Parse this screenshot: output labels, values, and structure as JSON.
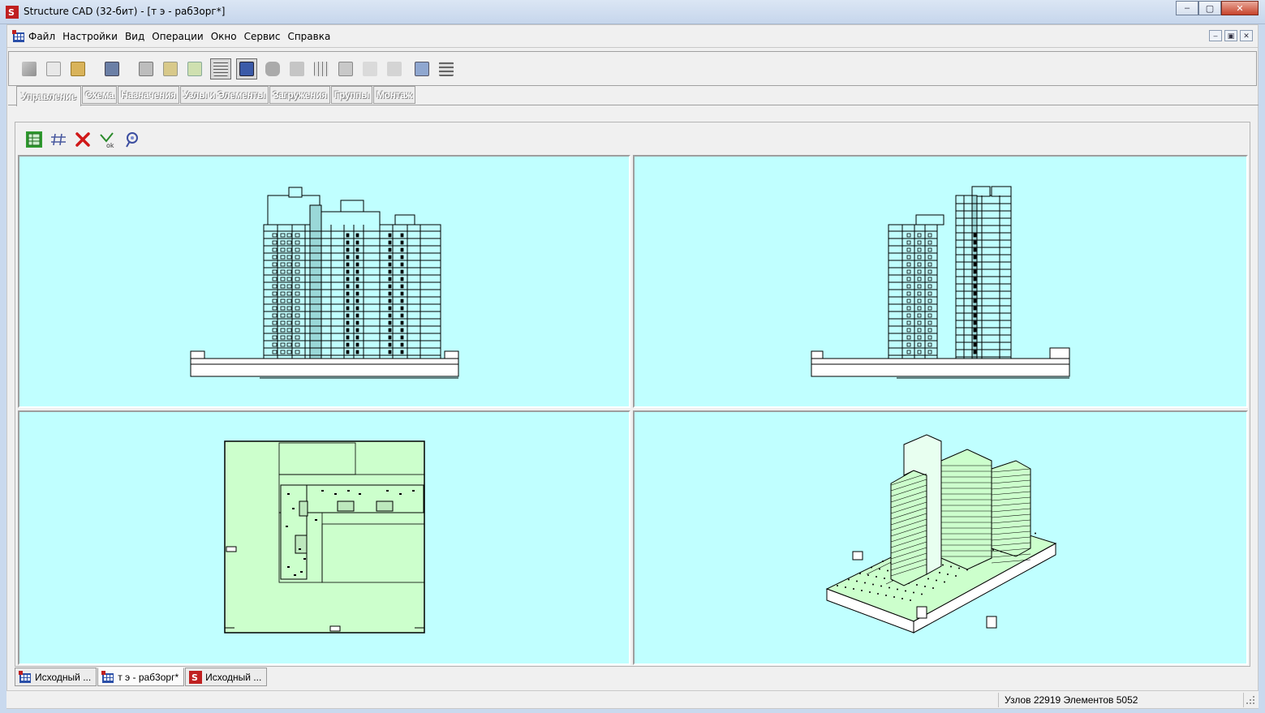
{
  "window": {
    "title": "Structure CAD (32-бит) - [т э - раб3орг*]",
    "controls": {
      "minimize": "‒",
      "maximize": "▢",
      "close": "✕"
    }
  },
  "menu": {
    "items": [
      "Файл",
      "Настройки",
      "Вид",
      "Операции",
      "Окно",
      "Сервис",
      "Справка"
    ],
    "mdi_controls": {
      "minimize": "‒",
      "restore": "▣",
      "close": "✕"
    }
  },
  "toolbar": {
    "buttons": [
      {
        "icon": "export-icon"
      },
      {
        "icon": "new-file-icon"
      },
      {
        "icon": "open-folder-icon"
      },
      {
        "icon": "save-icon"
      },
      {
        "icon": "print-icon"
      },
      {
        "icon": "tree-icon"
      },
      {
        "icon": "scheme-edit-icon"
      },
      {
        "icon": "grid-view-icon",
        "pressed": true
      },
      {
        "icon": "calculator-icon",
        "pressed": true
      },
      {
        "icon": "camera-icon"
      },
      {
        "icon": "results-icon"
      },
      {
        "icon": "table-icon"
      },
      {
        "icon": "docs-icon"
      },
      {
        "icon": "graph-icon"
      },
      {
        "icon": "analysis-icon"
      },
      {
        "icon": "design-icon"
      },
      {
        "icon": "report-icon"
      }
    ]
  },
  "tabs": [
    {
      "label": "Управление",
      "active": true
    },
    {
      "label": "Схема"
    },
    {
      "label": "Назначения"
    },
    {
      "label": "Узлы и Элементы"
    },
    {
      "label": "Загружения"
    },
    {
      "label": "Группы"
    },
    {
      "label": "Монтаж"
    }
  ],
  "view_toolbar": [
    "table-view-icon",
    "lines-icon",
    "delete-icon",
    "ok-icon",
    "satellite-icon"
  ],
  "viewports": [
    "front-view",
    "side-view",
    "plan-view",
    "isometric-view"
  ],
  "document_tabs": [
    {
      "label": "Исходный ...",
      "icon": "scad-doc-icon"
    },
    {
      "label": "т э - раб3орг*",
      "icon": "scad-doc-icon",
      "active": true
    },
    {
      "label": "Исходный ...",
      "icon": "scad-app-icon"
    }
  ],
  "status": {
    "text": "Узлов 22919 Элементов 5052"
  },
  "colors": {
    "viewport_bg": "#c0ffff",
    "plan_fill": "#ccffcc",
    "accent_red": "#cc2222"
  }
}
